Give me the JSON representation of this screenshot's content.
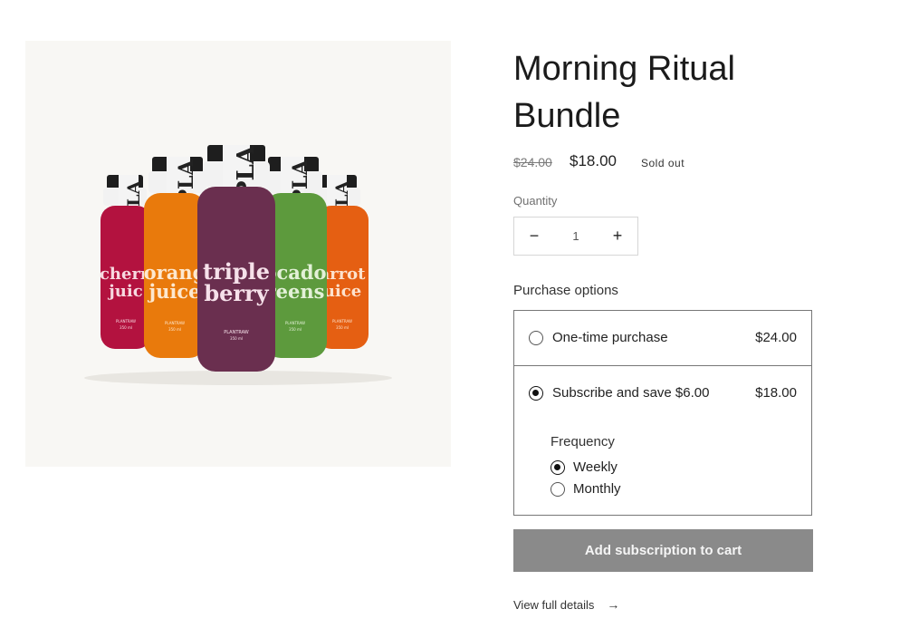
{
  "product": {
    "title_line1": "Morning Ritual",
    "title_line2": "Bundle",
    "price_compare": "$24.00",
    "price_current": "$18.00",
    "badge": "Sold out",
    "image": {
      "bottles": [
        {
          "line1": "chern",
          "line2": "juic",
          "brand": "PLANTRAW",
          "volume": "350 ml",
          "color": "#b3123f"
        },
        {
          "line1": "orang",
          "line2": "juice",
          "brand": "PLANTRAW",
          "volume": "350 ml",
          "color": "#e97a0c"
        },
        {
          "line1": "triple",
          "line2": "berry",
          "brand": "PLANTRAW",
          "volume": "350 ml",
          "color": "#6a2f4f"
        },
        {
          "line1": "ocado",
          "line2": "reens",
          "brand": "PLANTRAW",
          "volume": "350 ml",
          "color": "#5d9a3d"
        },
        {
          "line1": "arrot",
          "line2": "uice",
          "brand": "PLANTRAW",
          "volume": "350 ml",
          "color": "#e55f12"
        }
      ],
      "cap_text": "PLA"
    }
  },
  "quantity": {
    "label": "Quantity",
    "value": "1",
    "minus": "−",
    "plus": "+"
  },
  "purchase_options": {
    "label": "Purchase options",
    "one_time": {
      "label": "One-time purchase",
      "price": "$24.00",
      "selected": false
    },
    "subscribe": {
      "label": "Subscribe and save $6.00",
      "price": "$18.00",
      "selected": true
    },
    "frequency": {
      "label": "Frequency",
      "options": [
        {
          "label": "Weekly",
          "selected": true
        },
        {
          "label": "Monthly",
          "selected": false
        }
      ]
    }
  },
  "cta": {
    "label": "Add subscription to cart"
  },
  "details_link": {
    "label": "View full details",
    "arrow": "→"
  }
}
